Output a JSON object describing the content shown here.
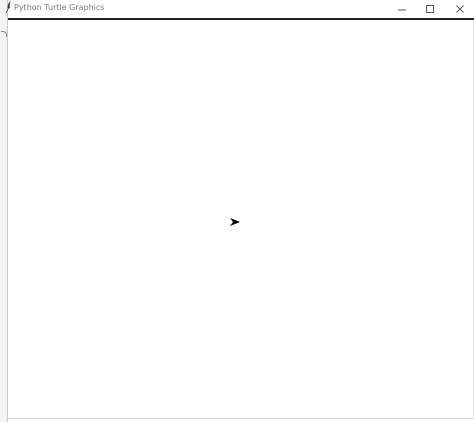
{
  "window": {
    "title": "Python Turtle Graphics",
    "icons": {
      "app": "feather-icon",
      "minimize": "minimize-icon",
      "maximize": "maximize-icon",
      "close": "close-icon"
    }
  },
  "canvas": {
    "background": "#ffffff",
    "turtle": {
      "shape": "arrow",
      "color": "#000000",
      "heading": "east"
    }
  }
}
